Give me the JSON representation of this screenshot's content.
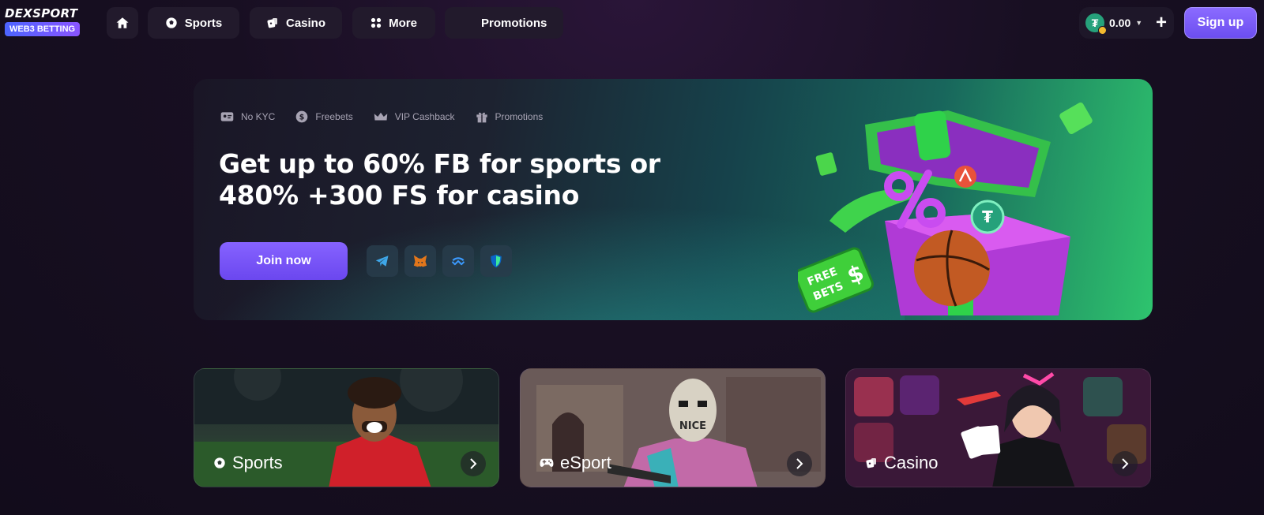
{
  "header": {
    "logo_text": "DEXSPORT",
    "logo_badge": "WEB3 BETTING",
    "nav": [
      {
        "label": "Sports",
        "icon": "soccer-ball-icon"
      },
      {
        "label": "Casino",
        "icon": "dice-icon"
      },
      {
        "label": "More",
        "icon": "grid-icon"
      },
      {
        "label": "Promotions",
        "icon": "none"
      }
    ],
    "home_icon": "home-icon",
    "balance": "0.00",
    "currency_icon": "tether-coin-icon",
    "plus_label": "+",
    "signup_label": "Sign up"
  },
  "hero": {
    "features": [
      {
        "label": "No KYC",
        "icon": "id-card-icon"
      },
      {
        "label": "Freebets",
        "icon": "dollar-coin-icon"
      },
      {
        "label": "VIP Cashback",
        "icon": "crown-icon"
      },
      {
        "label": "Promotions",
        "icon": "gift-icon"
      }
    ],
    "title_line1": "Get up to 60% FB for sports or",
    "title_line2": "480% +300 FS for casino",
    "join_label": "Join now",
    "wallets": [
      "telegram-icon",
      "metamask-icon",
      "walletconnect-icon",
      "trustwallet-icon"
    ],
    "illustration_text_1": "FREE",
    "illustration_text_2": "BETS"
  },
  "cards": [
    {
      "label": "Sports",
      "icon": "soccer-ball-icon"
    },
    {
      "label": "eSport",
      "icon": "gamepad-icon"
    },
    {
      "label": "Casino",
      "icon": "dice-icon"
    }
  ],
  "colors": {
    "accent": "#7b5cff",
    "background": "#160f1f",
    "nav_bg": "#221a2c",
    "tether": "#26a17b"
  }
}
